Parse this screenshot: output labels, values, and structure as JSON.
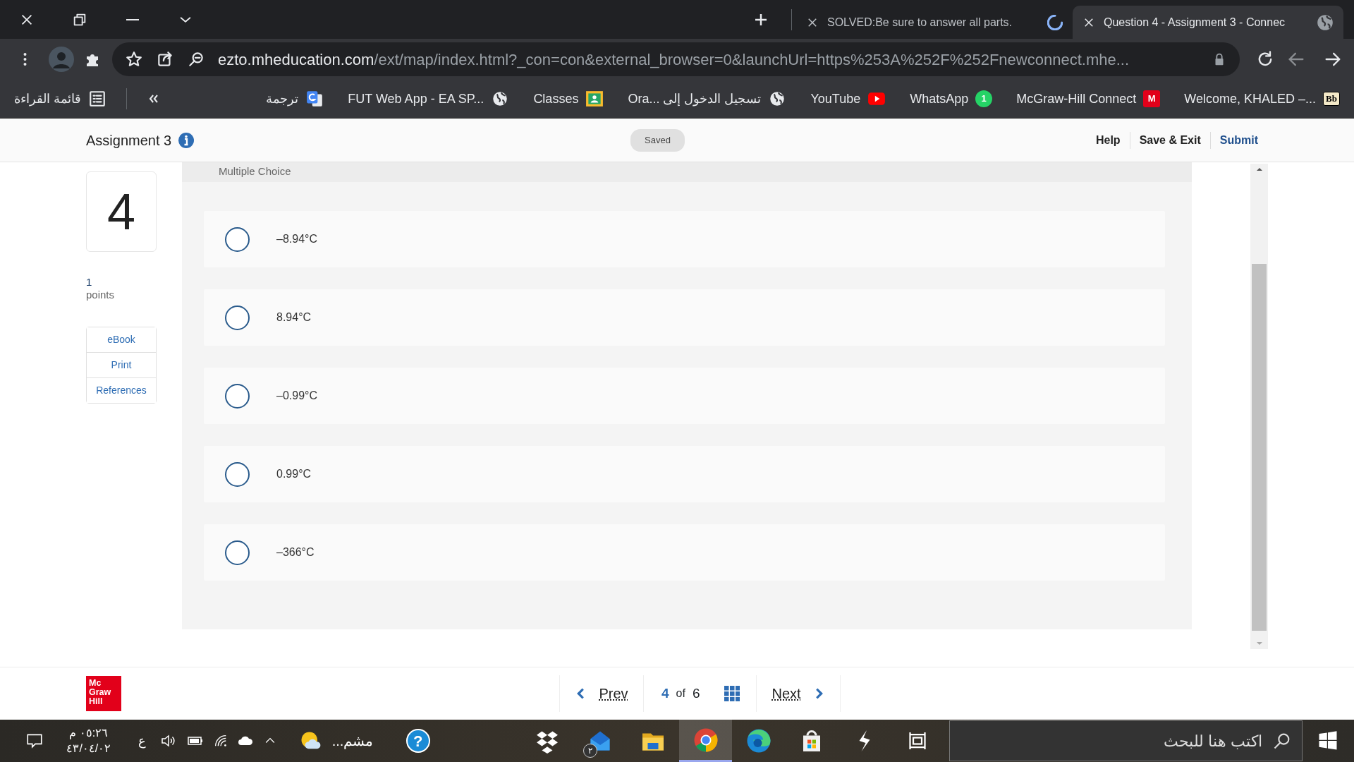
{
  "browser": {
    "tabs": [
      {
        "title": "SOLVED:Be sure to answer all parts.",
        "selected": false,
        "loading": true
      },
      {
        "title": "Question 4 - Assignment 3 - Connec",
        "selected": true,
        "loading": false
      }
    ],
    "url_host": "ezto.mheducation.com",
    "url_path": "/ext/map/index.html?_con=con&external_browser=0&launchUrl=https%253A%252F%252Fnewconnect.mhe...",
    "nav": [
      {
        "kind": "back",
        "disabled": false
      },
      {
        "kind": "forward",
        "disabled": true
      }
    ],
    "bookmarks": [
      {
        "label": "ترجمة",
        "kind": "translate"
      },
      {
        "label": "FUT Web App - EA SP...",
        "kind": "globe"
      },
      {
        "label": "Classes",
        "kind": "classroom"
      },
      {
        "label": "Ora... تسجيل الدخول إلى",
        "kind": "globe"
      },
      {
        "label": "YouTube",
        "kind": "youtube"
      },
      {
        "label": "WhatsApp",
        "kind": "logo",
        "icon_text": "1",
        "color": "#25d366"
      },
      {
        "label": "McGraw-Hill Connect",
        "kind": "logo",
        "icon_text": "M",
        "color": "#e2001a"
      },
      {
        "label": "Welcome, KHALED –...",
        "kind": "logo",
        "icon_text": "Bb",
        "color": "#f4e9c8"
      }
    ],
    "reading_list": "قائمة القراءة"
  },
  "app": {
    "assignment_title": "Assignment 3",
    "save_status": "Saved",
    "header_links": [
      {
        "label": "Help",
        "kind": "plain"
      },
      {
        "label": "Save & Exit",
        "kind": "plain"
      },
      {
        "label": "Submit",
        "kind": "primary"
      }
    ],
    "question": {
      "number": "4",
      "points_value": "1",
      "points_label": "points",
      "tools": [
        "eBook",
        "Print",
        "References"
      ],
      "type_label": "Multiple Choice",
      "options": [
        {
          "label": "–8.94°C",
          "selected": false
        },
        {
          "label": "8.94°C",
          "selected": false
        },
        {
          "label": "–0.99°C",
          "selected": false
        },
        {
          "label": "0.99°C",
          "selected": false
        },
        {
          "label": "–366°C",
          "selected": false
        }
      ]
    },
    "logo": [
      "Mc",
      "Graw",
      "Hill"
    ],
    "pager": {
      "prev": "Prev",
      "current": "4",
      "of": "of",
      "total": "6",
      "next": "Next"
    }
  },
  "taskbar": {
    "time": "٠٥:٢٦ م",
    "date": "٤٣/٠٤/٠٢",
    "input_language": "ع",
    "weather": "مشم...",
    "help_glyph": "?",
    "apps": [
      {
        "kind": "dropbox",
        "selected": false
      },
      {
        "kind": "mail",
        "selected": false,
        "badge": "٢"
      },
      {
        "kind": "folder",
        "selected": false
      },
      {
        "kind": "chrome",
        "selected": true
      },
      {
        "kind": "edge",
        "selected": false
      },
      {
        "kind": "store",
        "selected": false
      },
      {
        "kind": "bolt",
        "selected": false
      },
      {
        "kind": "taskview",
        "selected": false
      }
    ],
    "search_placeholder": "اكتب هنا للبحث"
  }
}
